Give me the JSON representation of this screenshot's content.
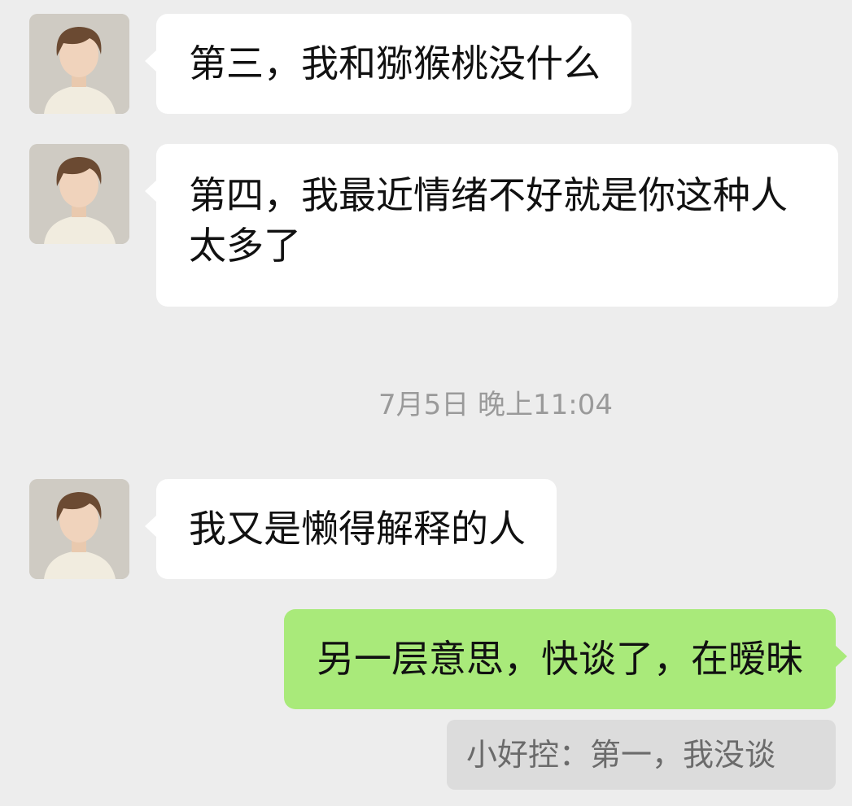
{
  "messages": [
    {
      "id": "m1",
      "direction": "incoming",
      "text": "第三，我和猕猴桃没什么"
    },
    {
      "id": "m2",
      "direction": "incoming",
      "text": "第四，我最近情绪不好就是你这种人太多了"
    },
    {
      "id": "m3",
      "direction": "incoming",
      "text": "我又是懒得解释的人"
    },
    {
      "id": "m4",
      "direction": "outgoing",
      "text": "另一层意思，快谈了，在暧昧"
    }
  ],
  "timestamp": "7月5日 晚上11:04",
  "quote": {
    "text": "小好控：第一，我没谈"
  },
  "colors": {
    "background": "#ededed",
    "incoming_bubble": "#ffffff",
    "outgoing_bubble": "#a9ea7a",
    "quote_background": "#dcdcdc",
    "timestamp_text": "#9a9a9a"
  },
  "icons": {
    "contact_avatar": "boy-avatar-icon"
  }
}
